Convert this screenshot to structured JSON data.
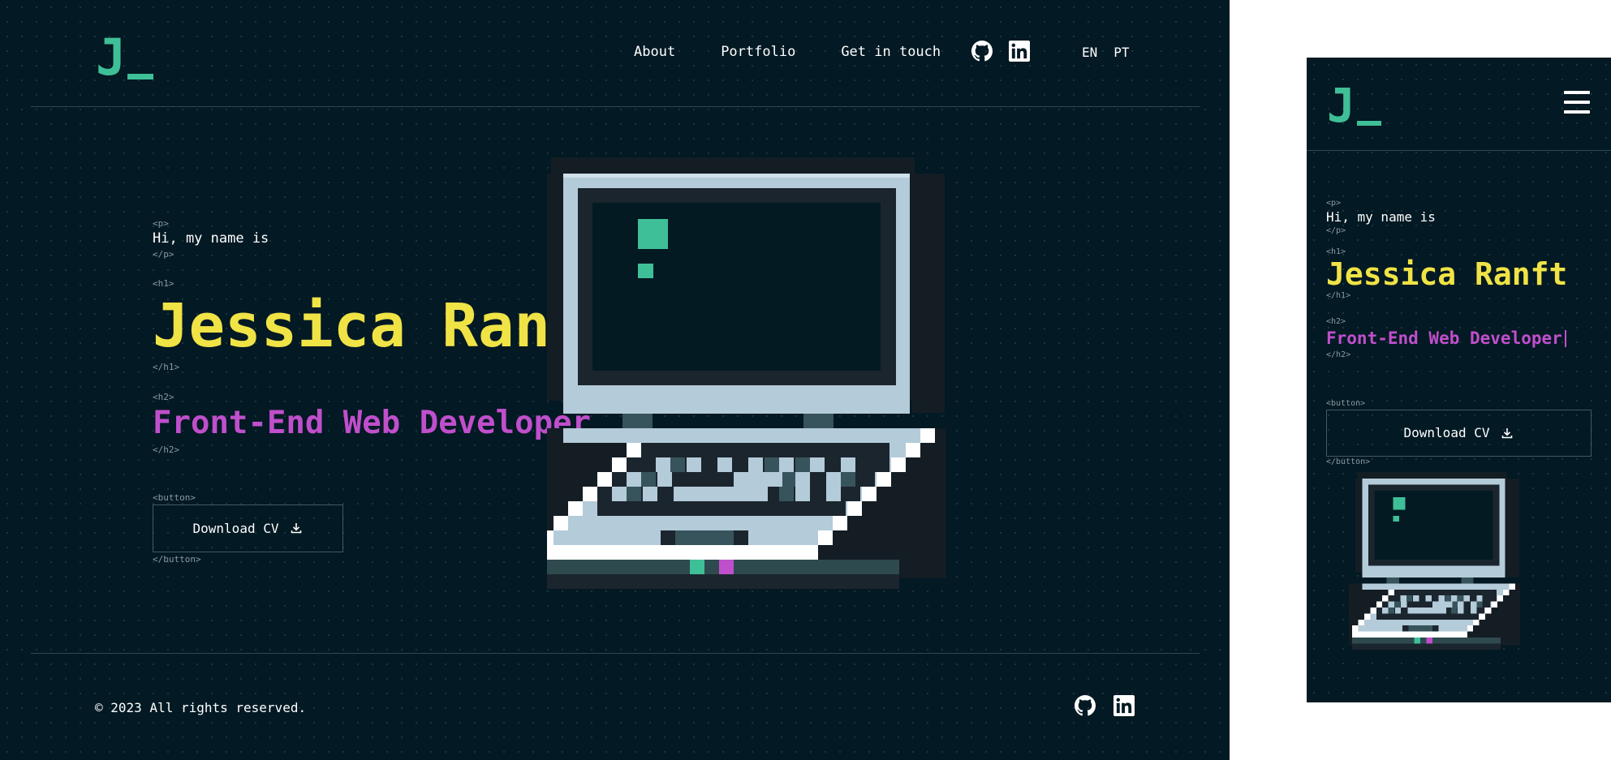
{
  "logo": {
    "letter": "J"
  },
  "nav": {
    "items": [
      "About",
      "Portfolio",
      "Get in touch"
    ]
  },
  "social": {
    "github": "github-icon",
    "linkedin": "linkedin-icon"
  },
  "languages": [
    "EN",
    "PT"
  ],
  "hero": {
    "tags": {
      "p_open": "<p>",
      "p_close": "</p>",
      "h1_open": "<h1>",
      "h1_close": "</h1>",
      "h2_open": "<h2>",
      "h2_close": "</h2>",
      "button_open": "<button>",
      "button_close": "</button>"
    },
    "greeting": "Hi, my name is",
    "name": "Jessica Ranft",
    "role": "Front-End Web Developer",
    "cv_button": "Download CV"
  },
  "footer": {
    "copyright": "© 2023 All rights reserved."
  },
  "mobile": {
    "menu_icon": "hamburger-menu-icon"
  },
  "colors": {
    "background": "#031923",
    "accent_green": "#3fbf97",
    "name_yellow": "#f0e346",
    "role_purple": "#c04fcc",
    "tag_gray": "#8a9ba3"
  }
}
